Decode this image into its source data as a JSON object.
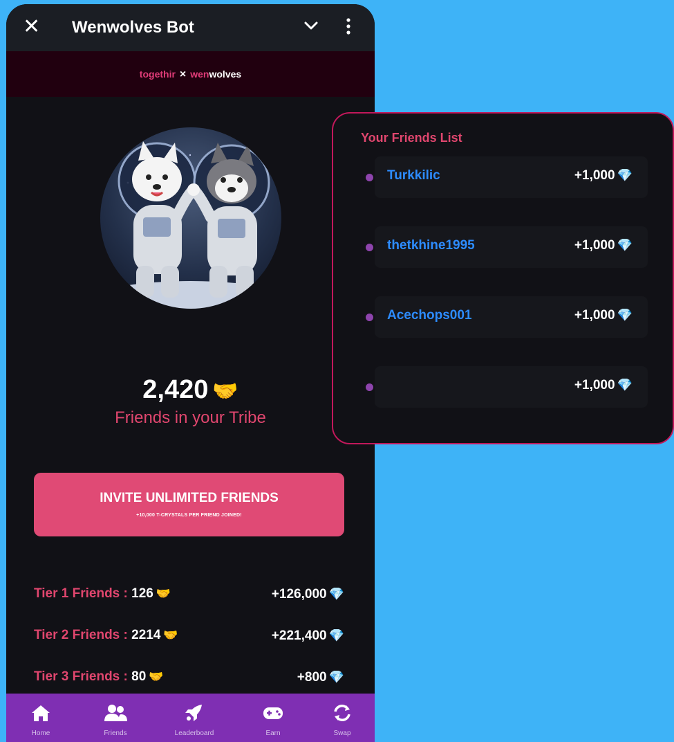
{
  "titlebar": {
    "title": "Wenwolves Bot",
    "close_icon": "close-icon",
    "menu_icon": "chevron-down-icon",
    "more_icon": "more-vertical-icon"
  },
  "banner": {
    "left": "togethir",
    "separator": "×",
    "right_part1": "wen",
    "right_part2": "wolves"
  },
  "stats": {
    "count": "2,420",
    "icon": "🤝",
    "label": "Friends in your Tribe"
  },
  "invite": {
    "title": "INVITE UNLIMITED FRIENDS",
    "subtitle": "+10,000 T-CRYSTALS PER FRIEND JOINED!"
  },
  "tiers": [
    {
      "label": "Tier 1 Friends :",
      "count": "126",
      "reward": "+126,000"
    },
    {
      "label": "Tier 2 Friends :",
      "count": "2214",
      "reward": "+221,400"
    },
    {
      "label": "Tier 3 Friends :",
      "count": "80",
      "reward": "+800"
    }
  ],
  "gem_icon": "💎",
  "nav": [
    {
      "label": "Home",
      "icon": "home-icon"
    },
    {
      "label": "Friends",
      "icon": "friends-icon"
    },
    {
      "label": "Leaderboard",
      "icon": "rocket-icon"
    },
    {
      "label": "Earn",
      "icon": "gamepad-icon"
    },
    {
      "label": "Swap",
      "icon": "swap-icon"
    }
  ],
  "friends_panel": {
    "title": "Your Friends List",
    "friends": [
      {
        "name": "Turkkilic",
        "reward": "+1,000"
      },
      {
        "name": "thetkhine1995",
        "reward": "+1,000"
      },
      {
        "name": "Acechops001",
        "reward": "+1,000"
      },
      {
        "name": "",
        "reward": "+1,000"
      }
    ]
  },
  "colors": {
    "background": "#3eb3f7",
    "accent_pink": "#e0466e",
    "nav_purple": "#7f2fb3",
    "friend_name_blue": "#2d8cff"
  }
}
